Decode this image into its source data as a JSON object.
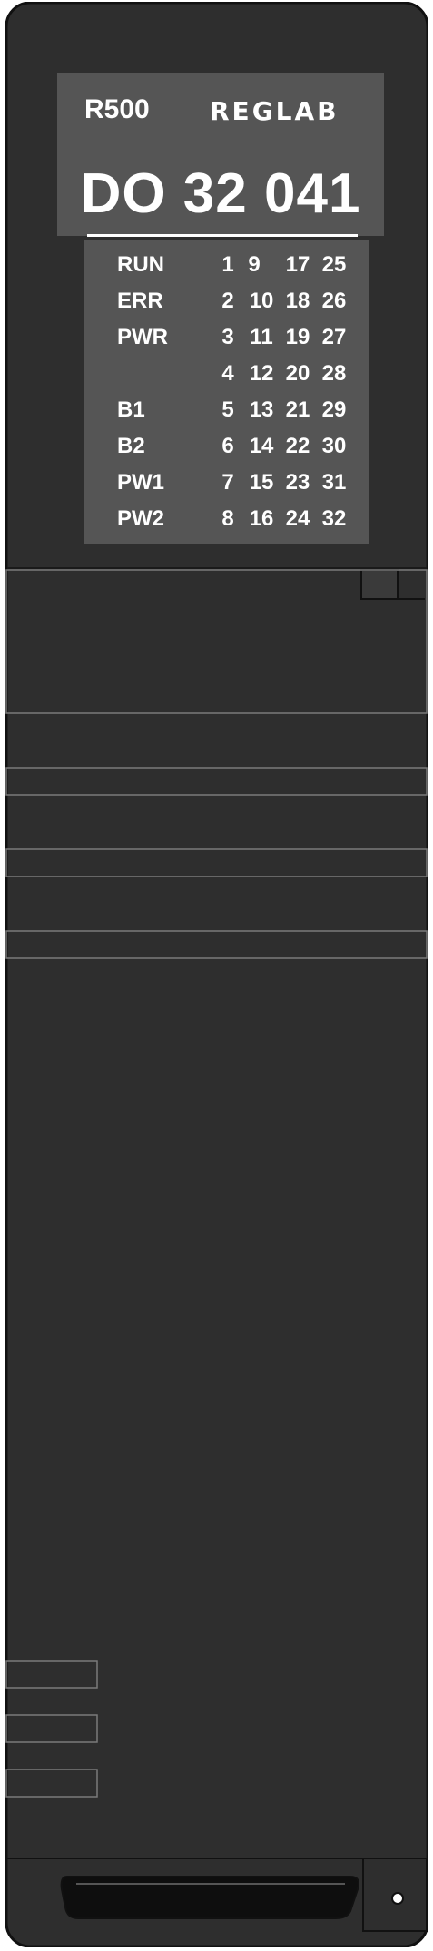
{
  "module": {
    "model": "R500",
    "brand": "REGLAB",
    "code": "DO 32 041"
  },
  "led_rows": [
    {
      "label": "RUN",
      "nums": [
        "1",
        "9",
        "17",
        "25"
      ]
    },
    {
      "label": "ERR",
      "nums": [
        "2",
        "10",
        "18",
        "26"
      ]
    },
    {
      "label": "PWR",
      "nums": [
        "3",
        "11",
        "19",
        "27"
      ]
    },
    {
      "label": "",
      "nums": [
        "4",
        "12",
        "20",
        "28"
      ]
    },
    {
      "label": "B1",
      "nums": [
        "5",
        "13",
        "21",
        "29"
      ]
    },
    {
      "label": "B2",
      "nums": [
        "6",
        "14",
        "22",
        "30"
      ]
    },
    {
      "label": "PW1",
      "nums": [
        "7",
        "15",
        "23",
        "31"
      ]
    },
    {
      "label": "PW2",
      "nums": [
        "8",
        "16",
        "24",
        "32"
      ]
    }
  ],
  "colors": {
    "body": "#2e2e2e",
    "panel": "#555555",
    "text": "#ffffff",
    "outline": "#111111"
  }
}
